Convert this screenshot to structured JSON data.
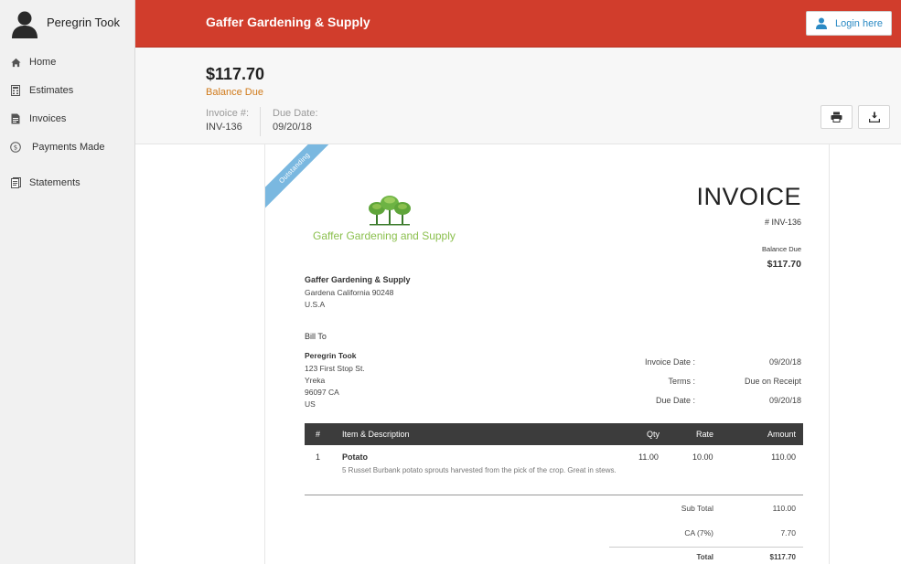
{
  "user": {
    "name": "Peregrin Took"
  },
  "nav": [
    {
      "label": "Home",
      "icon": "home-icon"
    },
    {
      "label": "Estimates",
      "icon": "estimates-icon"
    },
    {
      "label": "Invoices",
      "icon": "invoice-icon"
    },
    {
      "label": "Payments Made",
      "icon": "payments-icon"
    },
    {
      "label": "Statements",
      "icon": "statements-icon"
    }
  ],
  "header": {
    "org_name": "Gaffer Gardening & Supply",
    "login_label": "Login here"
  },
  "summary": {
    "amount": "$117.70",
    "balance_label": "Balance Due",
    "invoice_label": "Invoice #:",
    "invoice_value": "INV-136",
    "due_label": "Due Date:",
    "due_value": "09/20/18"
  },
  "doc": {
    "ribbon": "Outstanding",
    "logo_text": "Gaffer Gardening and Supply",
    "title": "INVOICE",
    "number": "# INV-136",
    "balance_label": "Balance Due",
    "balance_value": "$117.70",
    "from": {
      "name": "Gaffer Gardening & Supply",
      "line1": "Gardena California 90248",
      "line2": "U.S.A"
    },
    "bill_to_label": "Bill To",
    "bill_to": {
      "name": "Peregrin Took",
      "line1": "123 First Stop St.",
      "line2": "Yreka",
      "line3": "96097 CA",
      "line4": "US"
    },
    "info": [
      {
        "label": "Invoice Date :",
        "value": "09/20/18"
      },
      {
        "label": "Terms :",
        "value": "Due on Receipt"
      },
      {
        "label": "Due Date :",
        "value": "09/20/18"
      }
    ],
    "table": {
      "headers": {
        "num": "#",
        "item": "Item & Description",
        "qty": "Qty",
        "rate": "Rate",
        "amount": "Amount"
      },
      "rows": [
        {
          "num": "1",
          "name": "Potato",
          "desc": "5 Russet Burbank potato sprouts harvested from the pick of the crop. Great in stews.",
          "qty": "11.00",
          "rate": "10.00",
          "amount": "110.00"
        }
      ]
    },
    "totals": [
      {
        "label": "Sub Total",
        "value": "110.00"
      },
      {
        "label": "CA (7%)",
        "value": "7.70"
      },
      {
        "label": "Total",
        "value": "$117.70"
      }
    ]
  },
  "colors": {
    "brand_red": "#d13d2c",
    "balance_orange": "#d07a1a",
    "link_blue": "#2b8ac4",
    "ribbon_blue": "#7ab8e0",
    "logo_green": "#8cc04f"
  }
}
